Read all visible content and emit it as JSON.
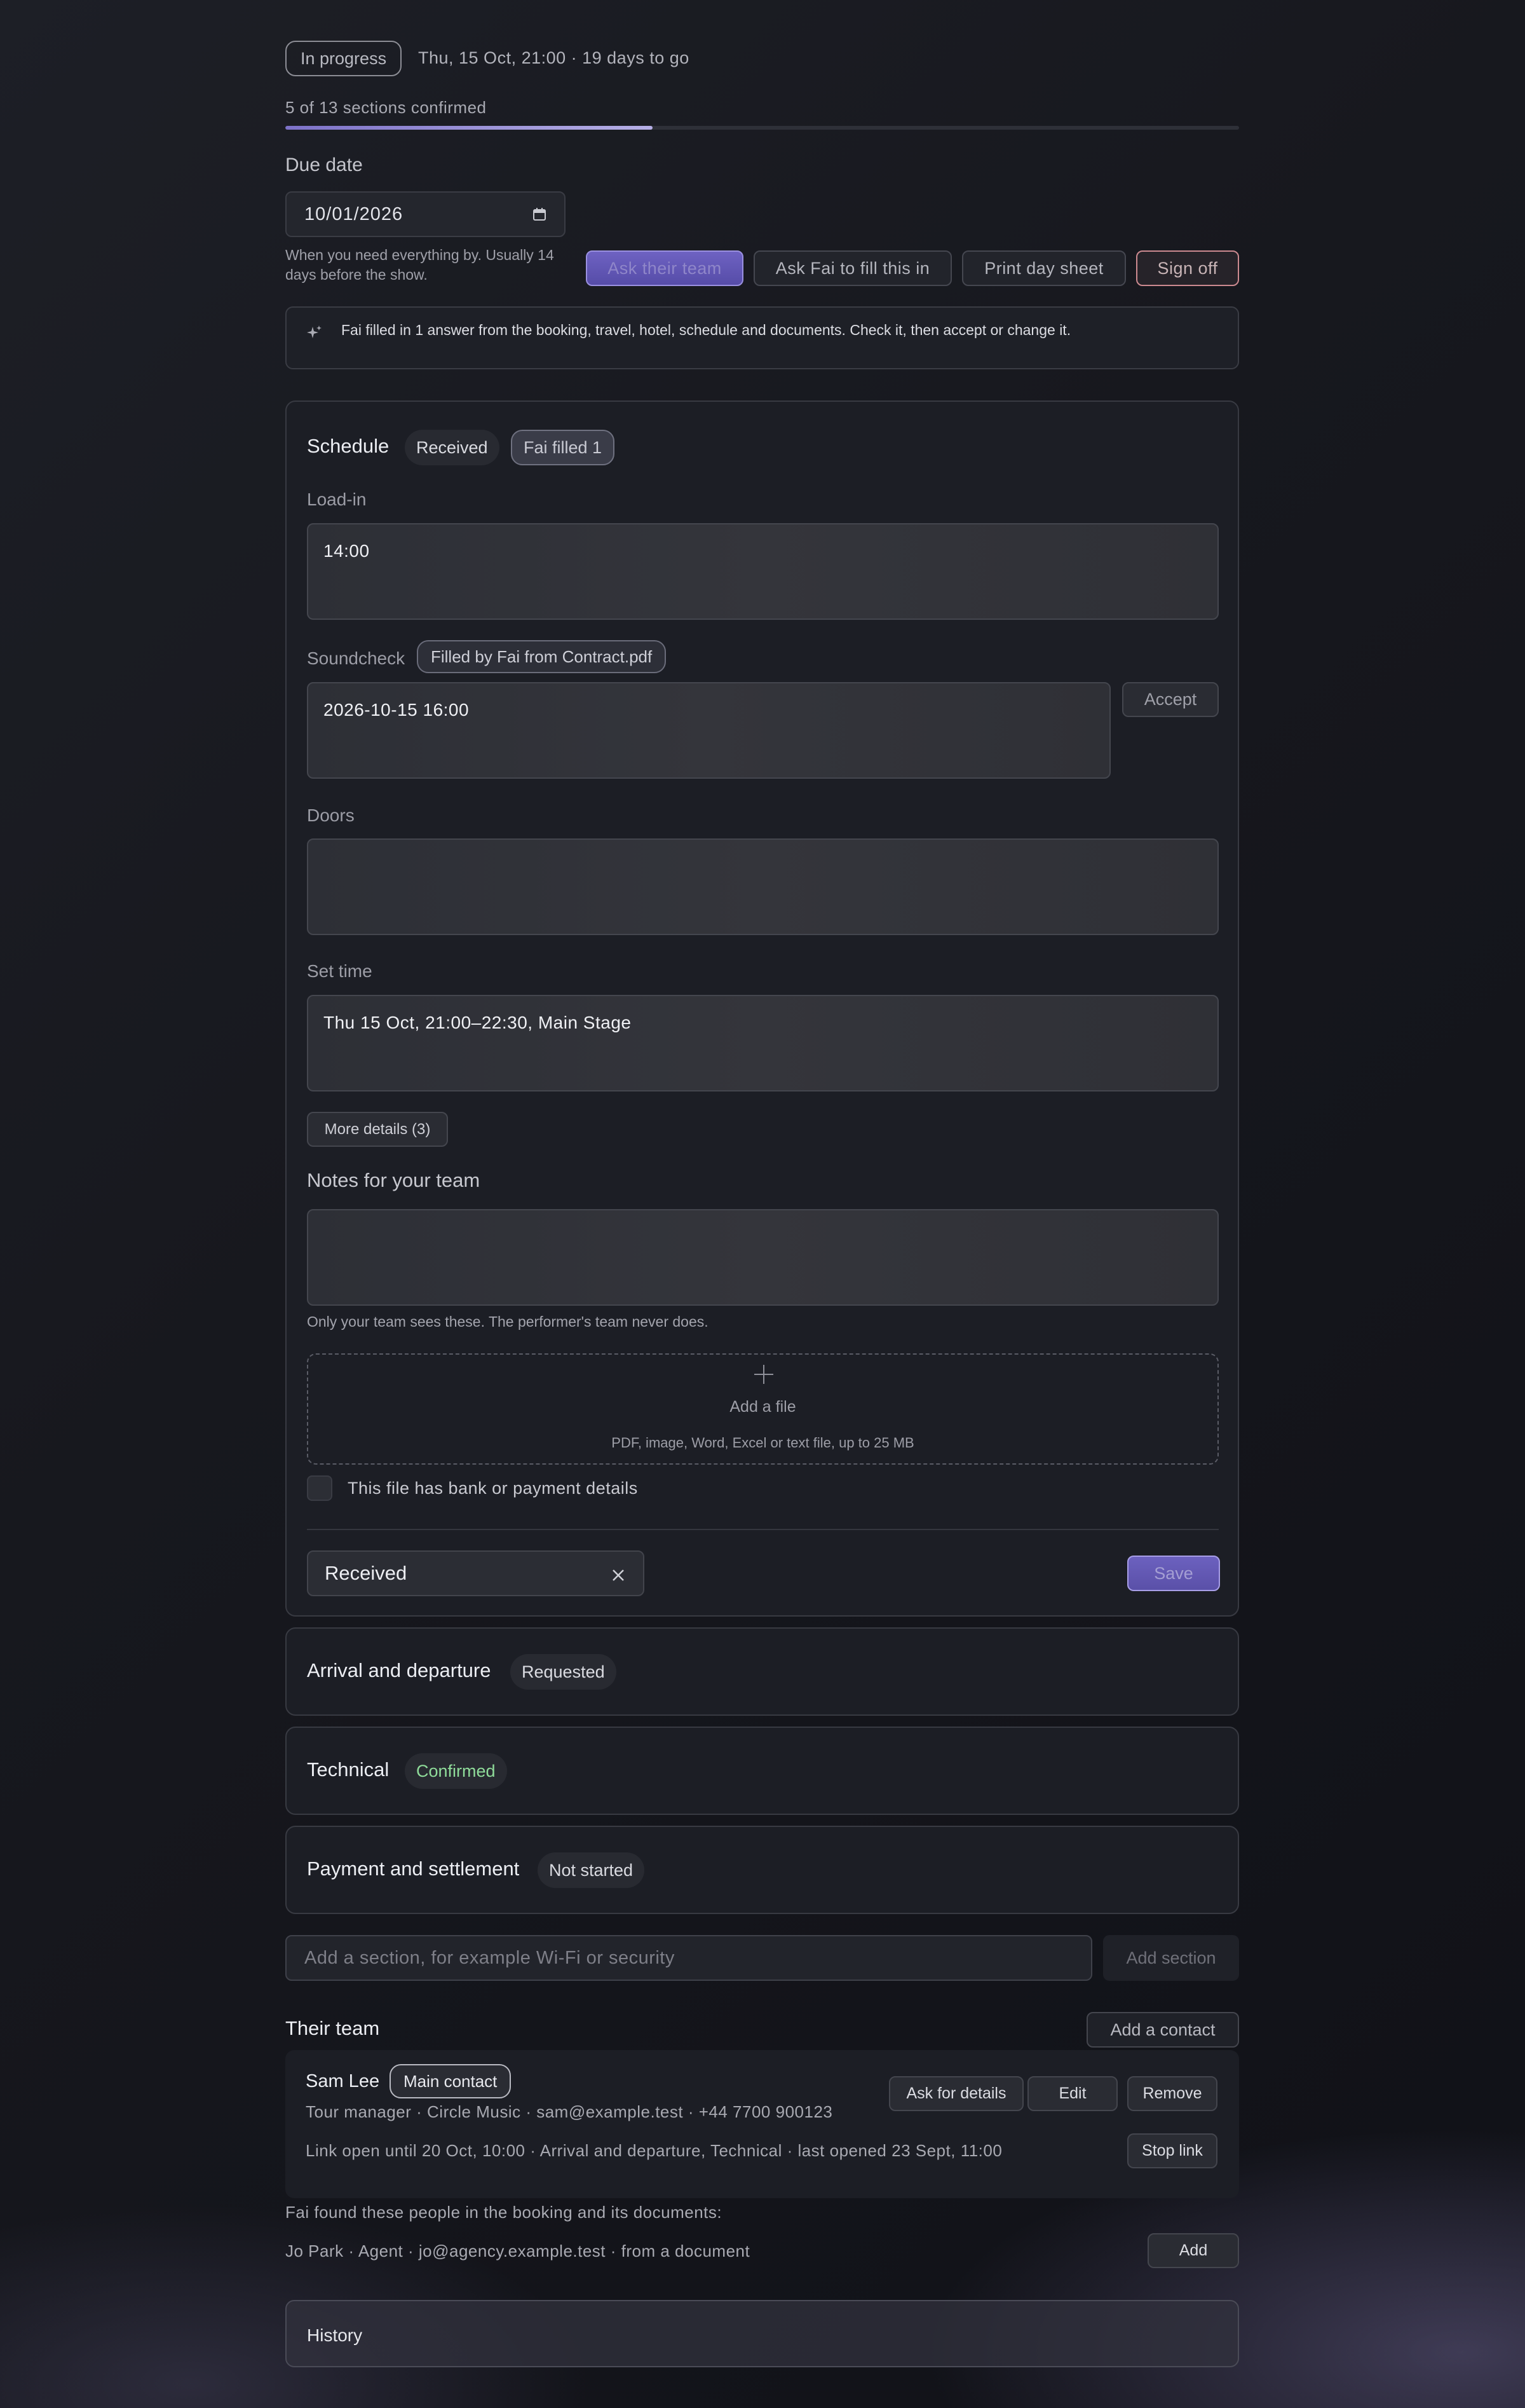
{
  "header": {
    "status": "In progress",
    "meta": "Thu, 15 Oct, 21:00 · 19 days to go",
    "progress_text": "5 of 13 sections confirmed",
    "progress_fraction": 0.385
  },
  "due": {
    "label": "Due date",
    "value": "10/01/2026",
    "help": "When you need everything by. Usually 14 days before the show."
  },
  "actions": {
    "ask_team": "Ask their team",
    "ask_fai": "Ask Fai to fill this in",
    "print": "Print day sheet",
    "sign_off": "Sign off"
  },
  "banner": {
    "text": "Fai filled in 1 answer from the booking, travel, hotel, schedule and documents. Check it, then accept or change it."
  },
  "schedule": {
    "title": "Schedule",
    "status": "Received",
    "fai_badge": "Fai filled 1",
    "fields": [
      {
        "label": "Load-in",
        "value": "14:00"
      },
      {
        "label": "Soundcheck",
        "value": "2026-10-15 16:00",
        "source": "Filled by Fai from Contract.pdf",
        "accept": "Accept"
      },
      {
        "label": "Doors",
        "value": ""
      },
      {
        "label": "Set time",
        "value": "Thu 15 Oct, 21:00–22:30, Main Stage"
      }
    ],
    "more_details": "More details (3)",
    "notes_label": "Notes for your team",
    "notes_help": "Only your team sees these. The performer's team never does.",
    "add_file": "Add a file",
    "file_types": "PDF, image, Word, Excel or text file, up to 25 MB",
    "bank_checkbox": "This file has bank or payment details",
    "status_select": "Received",
    "save": "Save"
  },
  "sections": [
    {
      "title": "Arrival and departure",
      "status": "Requested"
    },
    {
      "title": "Technical",
      "status": "Confirmed"
    },
    {
      "title": "Payment and settlement",
      "status": "Not started"
    }
  ],
  "add_section": {
    "placeholder": "Add a section, for example Wi-Fi or security",
    "button": "Add section"
  },
  "team": {
    "title": "Their team",
    "add_contact": "Add a contact",
    "contact": {
      "name": "Sam Lee",
      "badge": "Main contact",
      "meta": "Tour manager · Circle Music · sam@example.test · +44 7700 900123",
      "link": "Link open until 20 Oct, 10:00 · Arrival and departure, Technical · last opened 23 Sept, 11:00",
      "ask": "Ask for details",
      "edit": "Edit",
      "remove": "Remove",
      "stop": "Stop link"
    },
    "found_text": "Fai found these people in the booking and its documents:",
    "found_person": "Jo Park · Agent · jo@agency.example.test · from a document",
    "add": "Add"
  },
  "history": {
    "title": "History"
  },
  "colors": {
    "accent": "#6e62c2",
    "confirmed": "#8fdc9a",
    "signoff_border": "#cc8a90"
  }
}
